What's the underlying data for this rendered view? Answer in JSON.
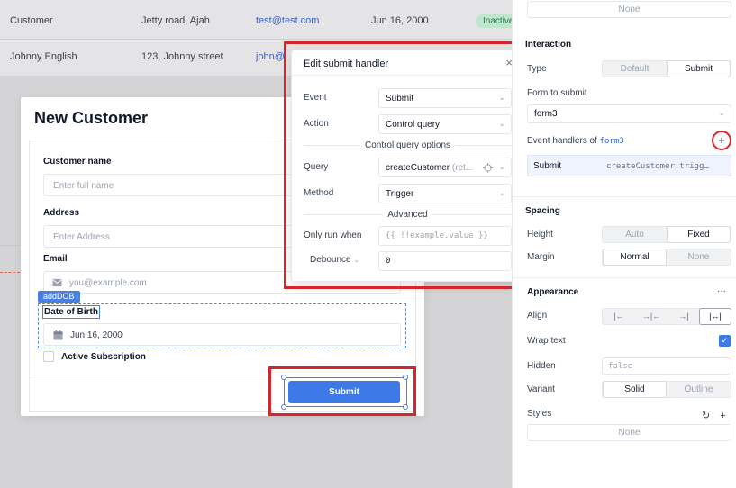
{
  "table": {
    "rows": [
      {
        "name": "Customer",
        "address": "Jetty road, Ajah",
        "email": "test@test.com",
        "date": "Jun 16, 2000",
        "badge": "Inactive"
      },
      {
        "name": "Johnny English",
        "address": "123, Johnny street",
        "email": "john@j"
      }
    ]
  },
  "modal": {
    "title": "New Customer",
    "customer_name_label": "Customer name",
    "customer_name_placeholder": "Enter full name",
    "address_label": "Address",
    "address_placeholder": "Enter Address",
    "email_label": "Email",
    "email_placeholder": "you@example.com",
    "dob_tag": "addDOB",
    "dob_label": "Date of Birth",
    "dob_value": "Jun 16, 2000",
    "checkbox_label": "Active Subscription",
    "submit_label": "Submit"
  },
  "popover": {
    "title": "Edit submit handler",
    "close": "×",
    "event_label": "Event",
    "event_value": "Submit",
    "action_label": "Action",
    "action_value": "Control query",
    "section_control": "Control query options",
    "query_label": "Query",
    "query_value": "createCustomer",
    "query_hint": "(ret...",
    "method_label": "Method",
    "method_value": "Trigger",
    "section_advanced": "Advanced",
    "only_run_label": "Only run when",
    "only_run_placeholder": "{{ !!example.value }}",
    "debounce_label": "Debounce",
    "debounce_value": "0"
  },
  "inspector": {
    "top_none": "None",
    "interaction_head": "Interaction",
    "type_label": "Type",
    "type_options": [
      "Default",
      "Submit"
    ],
    "type_selected": "Submit",
    "form_label": "Form to submit",
    "form_value": "form3",
    "handlers_label": "Event handlers of",
    "handlers_code": "form3",
    "handler_event": "Submit",
    "handler_action": "createCustomer.trigg…",
    "spacing_head": "Spacing",
    "height_label": "Height",
    "height_options": [
      "Auto",
      "Fixed"
    ],
    "margin_label": "Margin",
    "margin_options": [
      "Normal",
      "None"
    ],
    "appearance_head": "Appearance",
    "appearance_more": "···",
    "align_label": "Align",
    "wrap_label": "Wrap text",
    "hidden_label": "Hidden",
    "hidden_value": "false",
    "variant_label": "Variant",
    "variant_options": [
      "Solid",
      "Outline"
    ],
    "styles_label": "Styles",
    "styles_none": "None"
  },
  "colors": {
    "accent": "#3d7ae8",
    "annotation_red": "#d7262b",
    "badge_green": "#bfe7cd"
  }
}
